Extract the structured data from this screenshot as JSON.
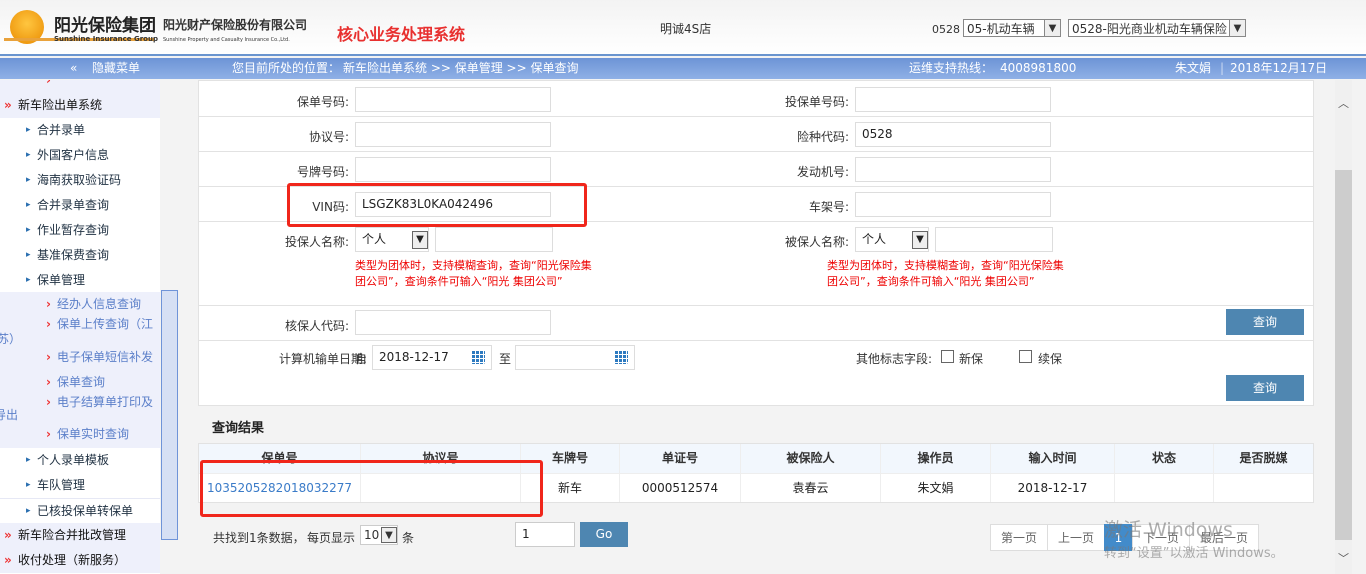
{
  "header": {
    "group_cn": "阳光保险集团",
    "group_en": "Sunshine Insurance Group",
    "company_cn": "阳光财产保险股份有限公司",
    "company_en": "Sunshine Property and Casualty Insurance Co.,Ltd.",
    "system_title": "核心业务处理系统",
    "dealer": "明诚4S店",
    "code": "0528",
    "select1": "05-机动车辆",
    "select2": "0528-阳光商业机动车辆保险"
  },
  "bar": {
    "hide_menu": "隐藏菜单",
    "breadcrumb_label": "您目前所处的位置：",
    "breadcrumb": "新车险出单系统 >> 保单管理 >> 保单查询",
    "hotline_label": "运维支持热线：",
    "hotline": "4008981800",
    "user": "朱文娟",
    "date": "2018年12月17日"
  },
  "sidebar": {
    "items": [
      {
        "label": "新车险出单系统"
      },
      {
        "label": "合并录单"
      },
      {
        "label": "外国客户信息"
      },
      {
        "label": "海南获取验证码"
      },
      {
        "label": "合并录单查询"
      },
      {
        "label": "作业暂存查询"
      },
      {
        "label": "基准保费查询"
      },
      {
        "label": "保单管理"
      },
      {
        "label": "经办人信息查询"
      },
      {
        "label": "保单上传查询（江"
      },
      {
        "label": "苏）"
      },
      {
        "label": "电子保单短信补发"
      },
      {
        "label": "保单查询"
      },
      {
        "label": "电子结算单打印及"
      },
      {
        "label": "导出"
      },
      {
        "label": "保单实时查询"
      },
      {
        "label": "个人录单模板"
      },
      {
        "label": "车队管理"
      },
      {
        "label": "已核投保单转保单"
      },
      {
        "label": "新车险合并批改管理"
      },
      {
        "label": "收付处理（新服务）"
      }
    ]
  },
  "form": {
    "policy_no": {
      "label": "保单号码:",
      "value": ""
    },
    "proposal_no": {
      "label": "投保单号码:",
      "value": ""
    },
    "agreement_no": {
      "label": "协议号:",
      "value": ""
    },
    "risk_code": {
      "label": "险种代码:",
      "value": "0528"
    },
    "plate_no": {
      "label": "号牌号码:",
      "value": ""
    },
    "engine_no": {
      "label": "发动机号:",
      "value": ""
    },
    "vin": {
      "label": "VIN码:",
      "value": "LSGZK83L0KA042496"
    },
    "frame_no": {
      "label": "车架号:",
      "value": ""
    },
    "applicant": {
      "label": "投保人名称:",
      "type": "个人",
      "value": ""
    },
    "insured": {
      "label": "被保人名称:",
      "type": "个人",
      "value": ""
    },
    "hint": "类型为团体时，支持模糊查询，查询“阳光保险集团公司”，查询条件可输入“阳光 集团公司”",
    "underwriter": {
      "label": "核保人代码:",
      "value": ""
    },
    "date": {
      "label": "计算机输单日期:",
      "from_label": "自",
      "from": "2018-12-17",
      "to_label": "至",
      "to": ""
    },
    "flags": {
      "label": "其他标志字段:",
      "new": "新保",
      "renew": "续保"
    },
    "query": "查询"
  },
  "results": {
    "title": "查询结果",
    "columns": [
      "保单号",
      "协议号",
      "车牌号",
      "单证号",
      "被保险人",
      "操作员",
      "输入时间",
      "状态",
      "是否脱媒"
    ],
    "rows": [
      [
        "1035205282018032277",
        "",
        "新车",
        "0000512574",
        "袁春云",
        "朱文娟",
        "2018-12-17",
        "",
        ""
      ]
    ]
  },
  "pager": {
    "found": "共找到1条数据，",
    "per_page_label": "每页显示",
    "per_page": "10",
    "unit": "条",
    "page_input": "1",
    "go": "Go",
    "first": "第一页",
    "prev": "上一页",
    "current": "1",
    "next": "下一页",
    "last": "最后一页"
  },
  "watermark": {
    "line1": "激活 Windows",
    "line2": "转到“设置”以激活 Windows。"
  }
}
